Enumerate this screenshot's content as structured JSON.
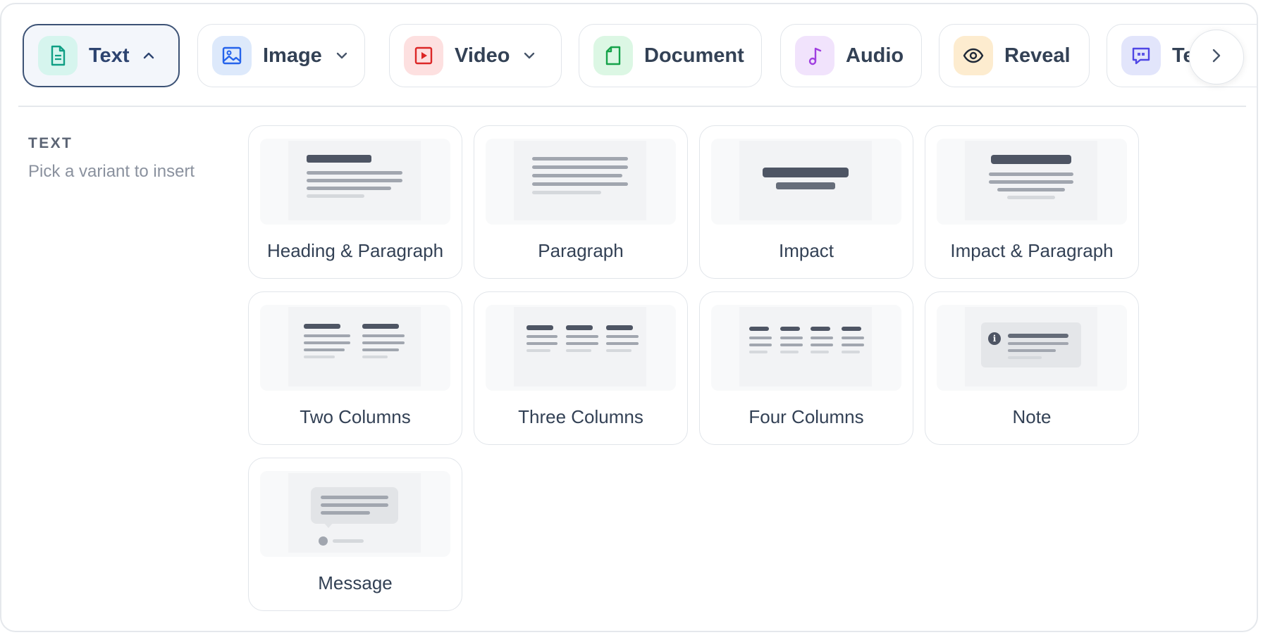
{
  "tabs": [
    {
      "label": "Text",
      "icon": "document-icon",
      "icon_bg": "#d6f5ee",
      "icon_color": "#0f9f84",
      "chevron": "up",
      "active": true
    },
    {
      "label": "Image",
      "icon": "image-icon",
      "icon_bg": "#dde9fb",
      "icon_color": "#2563eb",
      "chevron": "down",
      "active": false
    },
    {
      "label": "Video",
      "icon": "video-icon",
      "icon_bg": "#fde0e0",
      "icon_color": "#dc2626",
      "chevron": "down",
      "active": false
    },
    {
      "label": "Document",
      "icon": "file-icon",
      "icon_bg": "#dcf7e4",
      "icon_color": "#16a34a",
      "chevron": "",
      "active": false
    },
    {
      "label": "Audio",
      "icon": "music-note-icon",
      "icon_bg": "#f1e3fc",
      "icon_color": "#a03ee0",
      "chevron": "",
      "active": false
    },
    {
      "label": "Reveal",
      "icon": "eye-icon",
      "icon_bg": "#fdeccf",
      "icon_color": "#1f2937",
      "chevron": "",
      "active": false
    },
    {
      "label": "Te",
      "icon": "quote-message-icon",
      "icon_bg": "#e2e5fb",
      "icon_color": "#4f46e5",
      "chevron": "",
      "active": false
    }
  ],
  "section": {
    "title": "TEXT",
    "subtitle": "Pick a variant to insert"
  },
  "variants": [
    {
      "label": "Heading & Paragraph"
    },
    {
      "label": "Paragraph"
    },
    {
      "label": "Impact"
    },
    {
      "label": "Impact & Paragraph"
    },
    {
      "label": "Two Columns"
    },
    {
      "label": "Three Columns"
    },
    {
      "label": "Four Columns"
    },
    {
      "label": "Note"
    },
    {
      "label": "Message"
    }
  ],
  "colors": {
    "active_border": "#3c5275",
    "active_bg": "#f3f6fb",
    "text_primary": "#334155",
    "text_muted": "#8a919e"
  }
}
